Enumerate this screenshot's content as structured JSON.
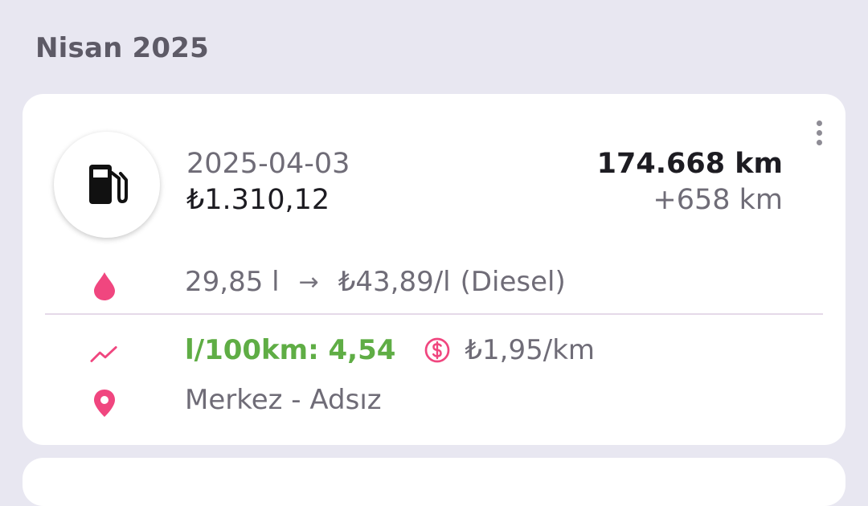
{
  "section": {
    "title": "Nisan 2025"
  },
  "entry": {
    "date": "2025-04-03",
    "cost": "₺1.310,12",
    "odometer": "174.668 km",
    "distance_delta": "+658 km",
    "fuel": {
      "amount": "29,85 l",
      "arrow": "→",
      "price_per_liter": "₺43,89/l",
      "type": "(Diesel)"
    },
    "consumption": "l/100km: 4,54",
    "cost_per_km": "₺1,95/km",
    "location": "Merkez - Adsız"
  },
  "icons": {
    "avatar": "fuel-pump-icon",
    "more": "more-vertical-icon",
    "fuel": "water-drop-icon",
    "consumption": "trending-line-icon",
    "cost": "dollar-circle-icon",
    "location": "map-pin-icon"
  },
  "colors": {
    "background": "#e8e7f1",
    "accent_pink": "#f0467f",
    "consumption_green": "#5fad45",
    "primary_text": "#1d1c22",
    "secondary_text": "#6f6c77"
  }
}
